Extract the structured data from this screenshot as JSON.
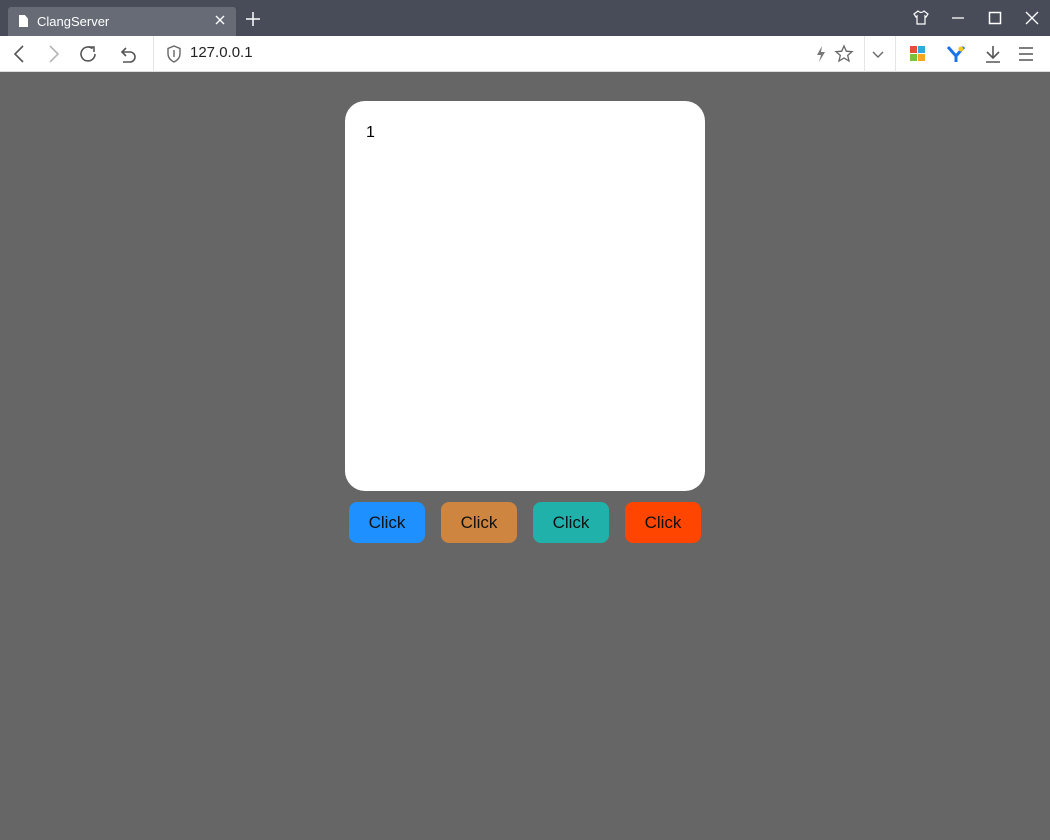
{
  "browser": {
    "tab": {
      "title": "ClangServer",
      "icon": "page-icon"
    },
    "address_bar": {
      "url": "127.0.0.1",
      "icon": "shield-icon"
    },
    "toolbar_icons": [
      "back-icon",
      "forward-icon",
      "reload-icon",
      "undo-icon",
      "lightning-icon",
      "star-icon",
      "chevron-down-icon",
      "apps-grid-icon",
      "extension-y-icon",
      "download-icon",
      "menu-icon"
    ],
    "window_controls": [
      "skin-icon",
      "minimize-icon",
      "maximize-icon",
      "close-icon"
    ]
  },
  "page": {
    "card": {
      "value": "1"
    },
    "buttons": [
      {
        "label": "Click",
        "color": "#1e90ff"
      },
      {
        "label": "Click",
        "color": "#cd853f"
      },
      {
        "label": "Click",
        "color": "#20b2aa"
      },
      {
        "label": "Click",
        "color": "#ff4500"
      }
    ],
    "colors": {
      "background": "#666666",
      "card": "#ffffff",
      "titlebar": "#474c58",
      "tab": "#666b76"
    }
  }
}
